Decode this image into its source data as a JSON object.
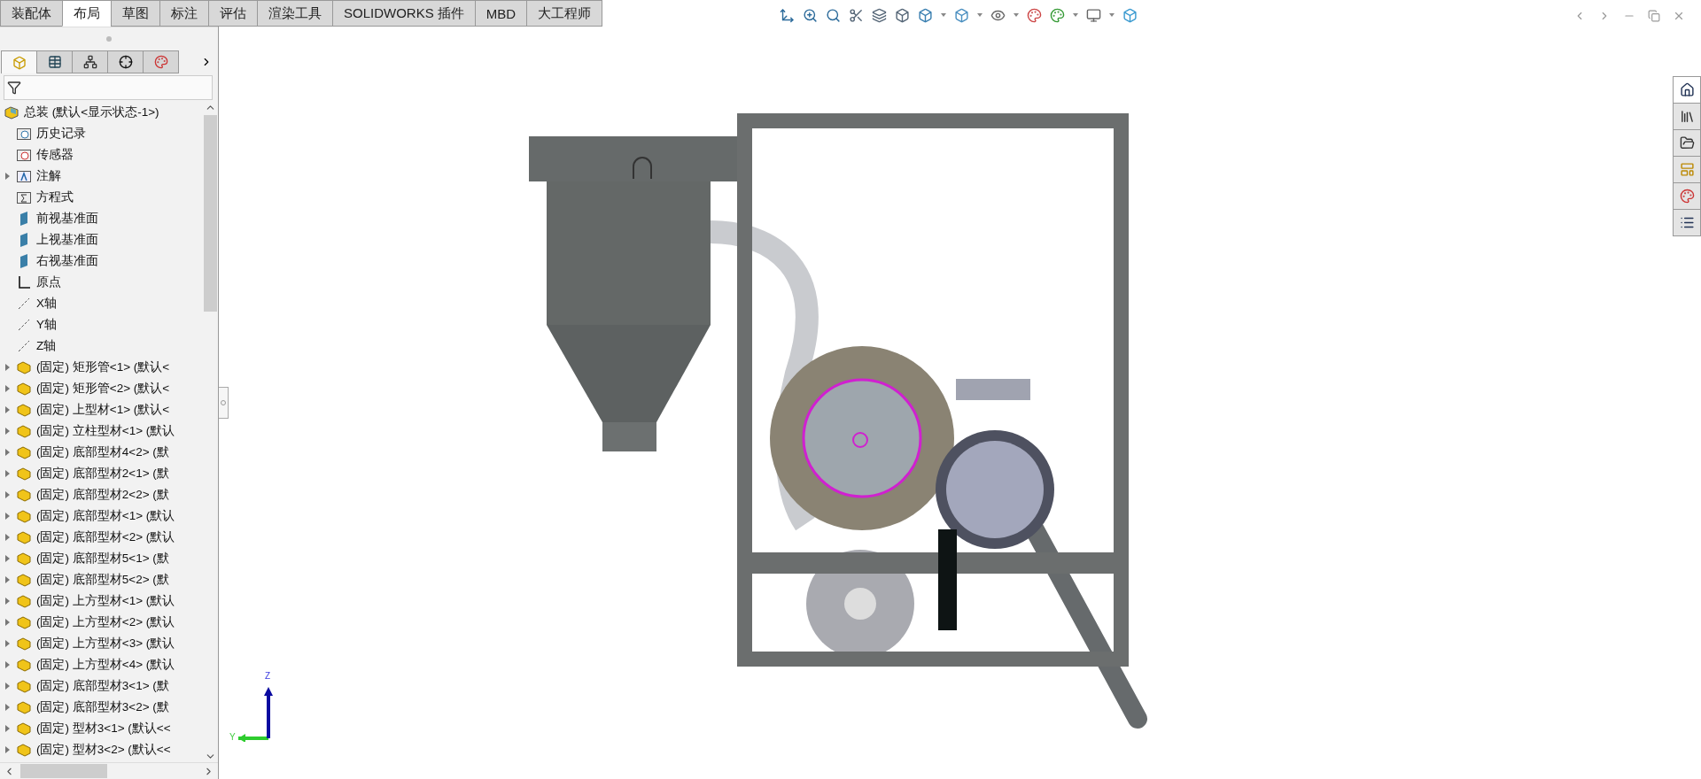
{
  "ribbon_tabs": [
    {
      "label": "装配体",
      "selected": false
    },
    {
      "label": "布局",
      "selected": true
    },
    {
      "label": "草图",
      "selected": false
    },
    {
      "label": "标注",
      "selected": false
    },
    {
      "label": "评估",
      "selected": false
    },
    {
      "label": "渲染工具",
      "selected": false
    },
    {
      "label": "SOLIDWORKS 插件",
      "selected": false
    },
    {
      "label": "MBD",
      "selected": false
    },
    {
      "label": "大工程师",
      "selected": false
    }
  ],
  "panel_tabs": [
    {
      "kind": "feature",
      "selected": true
    },
    {
      "kind": "property",
      "selected": false
    },
    {
      "kind": "config",
      "selected": false
    },
    {
      "kind": "dimxpert",
      "selected": false
    },
    {
      "kind": "display",
      "selected": false
    }
  ],
  "tree": {
    "label": "总装 (默认<显示状态-1>)",
    "children": [
      {
        "label": "历史记录",
        "kind": "history",
        "expandable": false
      },
      {
        "label": "传感器",
        "kind": "sensor",
        "expandable": false
      },
      {
        "label": "注解",
        "kind": "annotation",
        "expandable": true
      },
      {
        "label": "方程式",
        "kind": "equation",
        "expandable": false
      },
      {
        "label": "前视基准面",
        "kind": "plane",
        "expandable": false
      },
      {
        "label": "上视基准面",
        "kind": "plane",
        "expandable": false
      },
      {
        "label": "右视基准面",
        "kind": "plane",
        "expandable": false
      },
      {
        "label": "原点",
        "kind": "origin",
        "expandable": false
      },
      {
        "label": "X轴",
        "kind": "axis",
        "expandable": false
      },
      {
        "label": "Y轴",
        "kind": "axis",
        "expandable": false
      },
      {
        "label": "Z轴",
        "kind": "axis",
        "expandable": false
      },
      {
        "label": "(固定) 矩形管<1> (默认<",
        "kind": "part",
        "expandable": true
      },
      {
        "label": "(固定) 矩形管<2> (默认<",
        "kind": "part",
        "expandable": true
      },
      {
        "label": "(固定) 上型材<1> (默认<",
        "kind": "part",
        "expandable": true
      },
      {
        "label": "(固定) 立柱型材<1> (默认",
        "kind": "part",
        "expandable": true
      },
      {
        "label": "(固定) 底部型材4<2> (默",
        "kind": "part",
        "expandable": true
      },
      {
        "label": "(固定) 底部型材2<1> (默",
        "kind": "part",
        "expandable": true
      },
      {
        "label": "(固定) 底部型材2<2> (默",
        "kind": "part",
        "expandable": true
      },
      {
        "label": "(固定) 底部型材<1> (默认",
        "kind": "part",
        "expandable": true
      },
      {
        "label": "(固定) 底部型材<2> (默认",
        "kind": "part",
        "expandable": true
      },
      {
        "label": "(固定) 底部型材5<1> (默",
        "kind": "part",
        "expandable": true
      },
      {
        "label": "(固定) 底部型材5<2> (默",
        "kind": "part",
        "expandable": true
      },
      {
        "label": "(固定) 上方型材<1> (默认",
        "kind": "part",
        "expandable": true
      },
      {
        "label": "(固定) 上方型材<2> (默认",
        "kind": "part",
        "expandable": true
      },
      {
        "label": "(固定) 上方型材<3> (默认",
        "kind": "part",
        "expandable": true
      },
      {
        "label": "(固定) 上方型材<4> (默认",
        "kind": "part",
        "expandable": true
      },
      {
        "label": "(固定) 底部型材3<1> (默",
        "kind": "part",
        "expandable": true
      },
      {
        "label": "(固定) 底部型材3<2> (默",
        "kind": "part",
        "expandable": true
      },
      {
        "label": "(固定) 型材3<1> (默认<<",
        "kind": "part",
        "expandable": true
      },
      {
        "label": "(固定) 型材3<2> (默认<<",
        "kind": "part",
        "expandable": true
      }
    ]
  },
  "task_pane": [
    {
      "selected": true
    },
    {
      "selected": false
    },
    {
      "selected": false
    },
    {
      "selected": false
    },
    {
      "selected": false
    },
    {
      "selected": false
    }
  ],
  "triad": {
    "z_label": "Z",
    "y_label": "Y"
  }
}
